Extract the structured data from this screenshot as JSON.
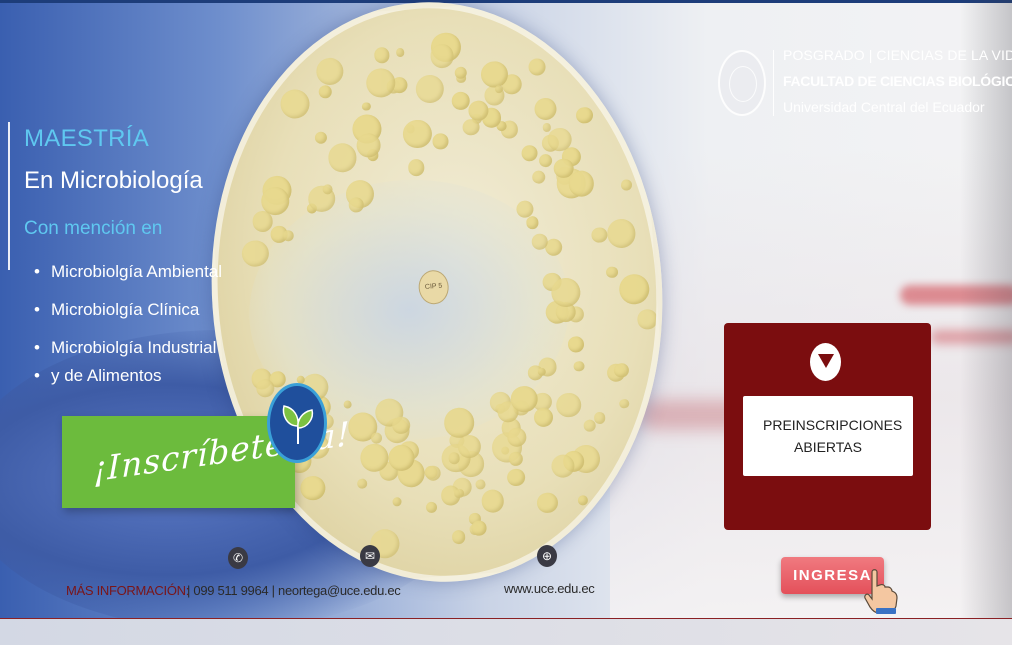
{
  "brand": {
    "line1": "POSGRADO | CIENCIAS DE LA VIDA",
    "line2": "FACULTAD DE CIENCIAS BIOLÓGICAS",
    "line3": "Universidad Central del Ecuador"
  },
  "program": {
    "degree": "MAESTRÍA",
    "name": "En Microbiología",
    "mention_label": "Con mención en",
    "mentions": [
      "Microbiolgía Ambiental",
      "Microbiolgía Clínica",
      "Microbiolgía Industrial",
      "y de Alimentos"
    ]
  },
  "cta": {
    "label": "¡Inscríbete ya!"
  },
  "card": {
    "text": "PREINSCRIPCIONES ABIERTAS"
  },
  "ingresa": {
    "label": "INGRESA"
  },
  "dish": {
    "disk_label": "CIP 5"
  },
  "footer": {
    "info_label": "MÁS INFORMACIÓN:",
    "contact": "|  099 511 9964 |  neortega@uce.edu.ec",
    "website": "www.uce.edu.ec"
  },
  "colors": {
    "accent_blue": "#5fc8f0",
    "card_red": "#7b0d0f",
    "cta_green": "#6cbb3d",
    "button_red": "#e4505a"
  },
  "icons": [
    "seal-logo",
    "chevron-down-icon",
    "leaf-icon",
    "whatsapp-icon",
    "mail-icon",
    "globe-icon",
    "pointer-hand-icon"
  ]
}
